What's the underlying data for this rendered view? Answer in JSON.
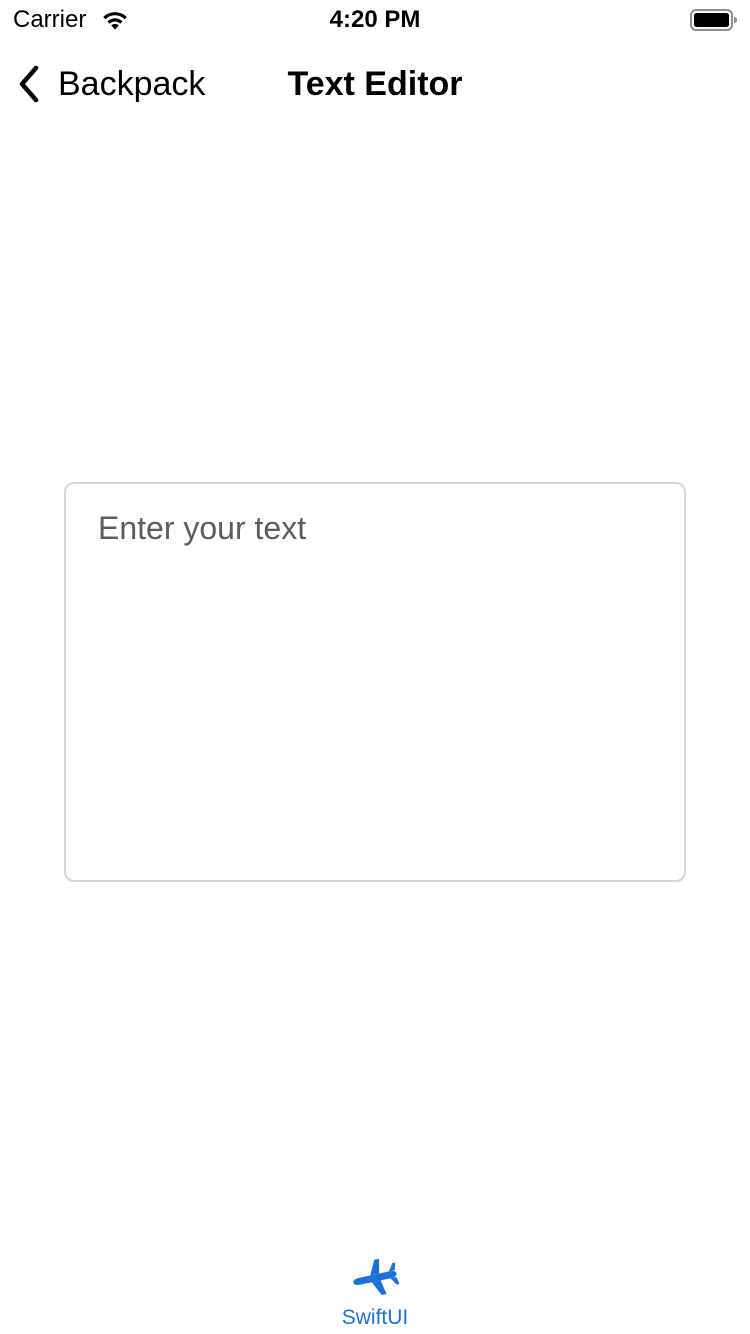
{
  "status_bar": {
    "carrier": "Carrier",
    "time": "4:20 PM",
    "wifi_icon": "wifi-icon",
    "battery_icon": "battery-icon"
  },
  "nav_bar": {
    "back_label": "Backpack",
    "back_icon": "chevron-left-icon",
    "title": "Text Editor"
  },
  "editor": {
    "placeholder": "Enter your text",
    "value": "",
    "border_color": "#d6d6d6",
    "placeholder_color": "#5c5c63"
  },
  "tab_bar": {
    "items": [
      {
        "label": "SwiftUI",
        "icon": "airplane-icon",
        "selected": true,
        "color": "#1f6fd8"
      }
    ]
  }
}
